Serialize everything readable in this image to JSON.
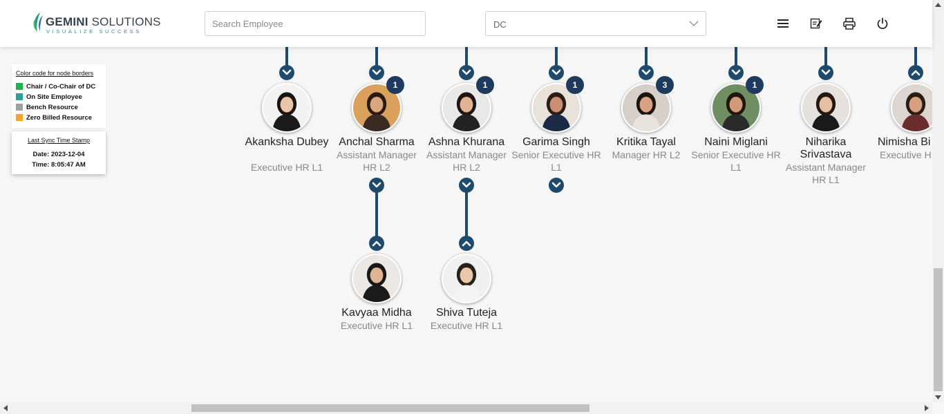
{
  "header": {
    "logo_text_bold": "GEMINI",
    "logo_text": "SOLUTIONS",
    "logo_tagline": "VISUALIZE SUCCESS",
    "search_placeholder": "Search Employee",
    "dept_select_value": "DC",
    "icons": [
      "hamburger-menu-icon",
      "edit-note-icon",
      "print-icon",
      "power-icon"
    ]
  },
  "legend": {
    "title": "Color code for node borders",
    "items": [
      {
        "label": "Chair / Co-Chair of DC",
        "color": "#22b14c"
      },
      {
        "label": "On Site Employee",
        "color": "#2aa198"
      },
      {
        "label": "Bench Resource",
        "color": "#a0a0a0"
      },
      {
        "label": "Zero Billed Resource",
        "color": "#f5a623"
      }
    ]
  },
  "sync": {
    "title": "Last Sync Time Stamp",
    "date": "Date: 2023-12-04",
    "time": "Time: 8:05:47 AM"
  },
  "employees": [
    {
      "name": "Akanksha Dubey",
      "role": "Executive HR L1"
    },
    {
      "name": "Anchal Sharma",
      "role": "Assistant Manager HR L2",
      "badge": "1"
    },
    {
      "name": "Ashna Khurana",
      "role": "Assistant Manager HR L2",
      "badge": "1"
    },
    {
      "name": "Garima Singh",
      "role": "Senior Executive HR L1",
      "badge": "1"
    },
    {
      "name": "Kritika Tayal",
      "role": "Manager HR L2",
      "badge": "3"
    },
    {
      "name": "Naini Miglani",
      "role": "Senior Executive HR L1",
      "badge": "1"
    },
    {
      "name": "Niharika Srivastava",
      "role": "Assistant Manager HR L1"
    },
    {
      "name": "Nimisha Bi",
      "role": "Executive H"
    }
  ],
  "sub_employees": [
    {
      "name": "Kavyaa Midha",
      "role": "Executive HR L1"
    },
    {
      "name": "Shiva Tuteja",
      "role": "Executive HR L1"
    }
  ],
  "colors": {
    "node_blue": "#1e4a6e",
    "badge_navy": "#1e3a5f"
  }
}
